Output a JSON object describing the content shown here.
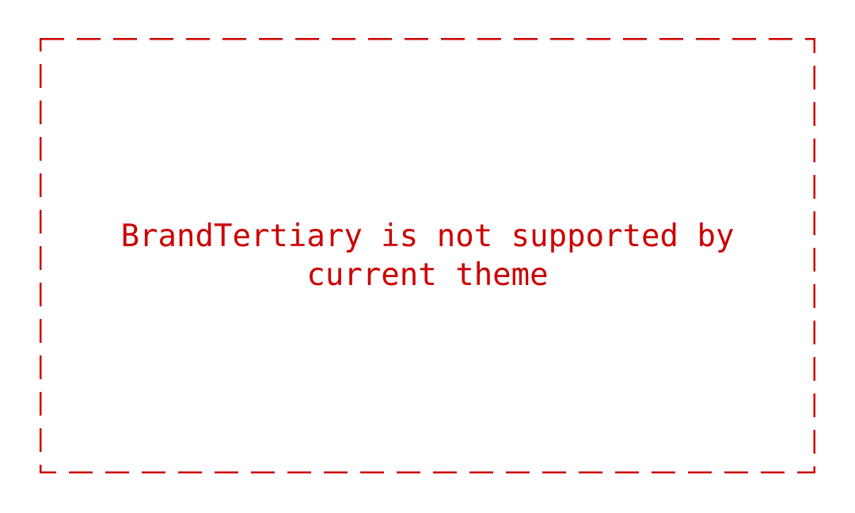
{
  "placeholder": {
    "message": "BrandTertiary is not supported by current theme",
    "color": "#cc0000"
  }
}
